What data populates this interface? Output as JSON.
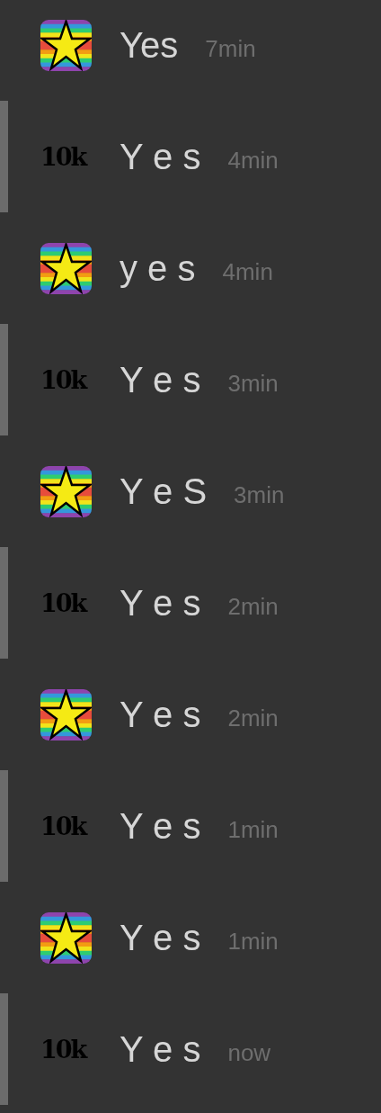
{
  "messages": [
    {
      "avatar": {
        "kind": "star"
      },
      "highlighted": false,
      "text": "Yes",
      "time": "7min"
    },
    {
      "avatar": {
        "kind": "text",
        "label": "10k"
      },
      "highlighted": true,
      "text": "Y e s",
      "time": "4min"
    },
    {
      "avatar": {
        "kind": "star"
      },
      "highlighted": false,
      "text": "y e s",
      "time": "4min"
    },
    {
      "avatar": {
        "kind": "text",
        "label": "10k"
      },
      "highlighted": true,
      "text": "Y e s",
      "time": "3min"
    },
    {
      "avatar": {
        "kind": "star"
      },
      "highlighted": false,
      "text": "Y e S",
      "time": "3min"
    },
    {
      "avatar": {
        "kind": "text",
        "label": "10k"
      },
      "highlighted": true,
      "text": "Y e s",
      "time": "2min"
    },
    {
      "avatar": {
        "kind": "star"
      },
      "highlighted": false,
      "text": "Y e s",
      "time": "2min"
    },
    {
      "avatar": {
        "kind": "text",
        "label": "10k"
      },
      "highlighted": true,
      "text": "Y e s",
      "time": "1min"
    },
    {
      "avatar": {
        "kind": "star"
      },
      "highlighted": false,
      "text": "Y e s",
      "time": "1min"
    },
    {
      "avatar": {
        "kind": "text",
        "label": "10k"
      },
      "highlighted": true,
      "text": "Y e s",
      "time": "now"
    }
  ]
}
